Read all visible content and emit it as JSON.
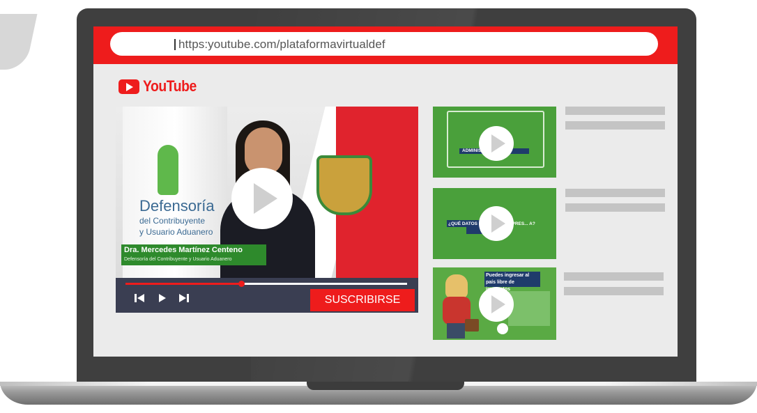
{
  "browser": {
    "url": "https:youtube.com/plataformavirtualdef"
  },
  "youtube": {
    "logo_text": "YouTube"
  },
  "main_video": {
    "org_title": "Defensoría",
    "org_sub1": "del Contribuyente",
    "org_sub2": "y Usuario Aduanero",
    "presenter_name": "Dra. Mercedes Martínez Centeno",
    "presenter_role": "Defensoría del Contribuyente y Usuario Aduanero",
    "progress": 0.41,
    "controls": {
      "prev_icon": "skip-previous-icon",
      "play_icon": "play-icon",
      "next_icon": "skip-next-icon"
    },
    "subscribe_label": "SUSCRIBIRSE"
  },
  "related_videos": [
    {
      "caption": "ADMINIS... TARIAS?"
    },
    {
      "caption": "¿QUÉ DATOS ... ONAR PARA PRES... A?"
    },
    {
      "caption": "Puedes ingresar al país libre de impuestos"
    }
  ],
  "colors": {
    "accent": "#ee1c1c",
    "controls_bg": "#3a3e52",
    "thumb_green": "#4aa03b"
  }
}
